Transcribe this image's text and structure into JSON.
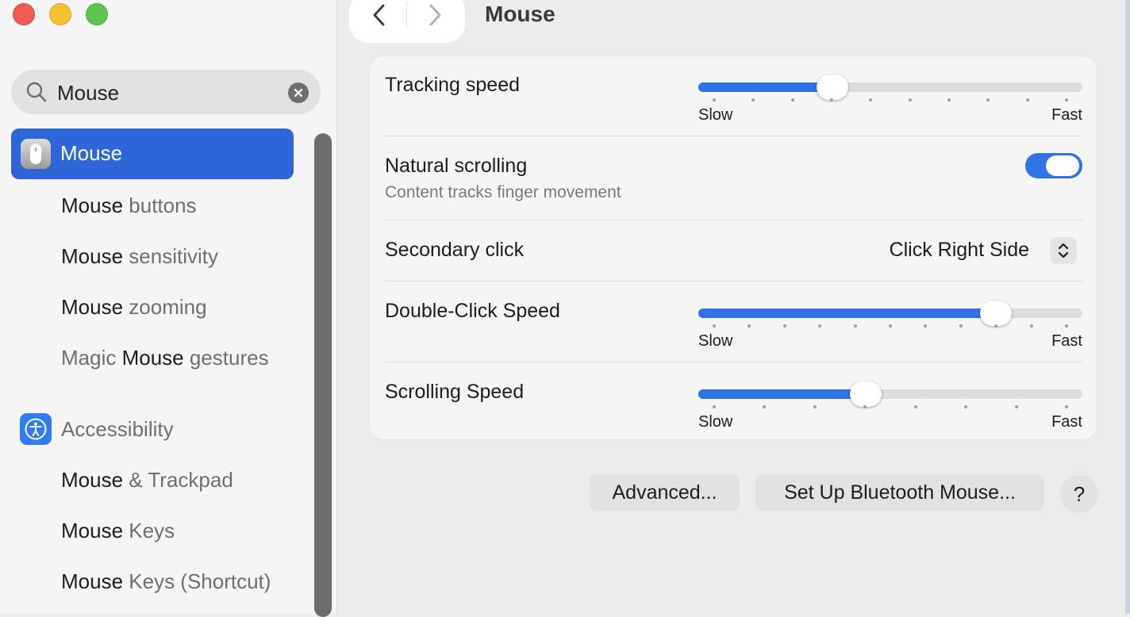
{
  "window": {
    "title": "Mouse"
  },
  "search": {
    "value": "Mouse"
  },
  "sidebar": {
    "selected": {
      "label": "Mouse",
      "icon": "mouse-icon"
    },
    "items": [
      {
        "match": "Mouse",
        "rest": " buttons"
      },
      {
        "match": "Mouse",
        "rest": " sensitivity"
      },
      {
        "match": "Mouse",
        "rest": " zooming"
      },
      {
        "pre": "Magic ",
        "match": "Mouse",
        "rest": " gestures"
      }
    ],
    "accessibility": {
      "label": "Accessibility",
      "icon": "accessibility-icon",
      "items": [
        {
          "match": "Mouse",
          "rest": " & Trackpad"
        },
        {
          "match": "Mouse",
          "rest": " Keys"
        },
        {
          "match": "Mouse",
          "rest": " Keys (Shortcut)"
        }
      ]
    }
  },
  "settings": {
    "tracking_speed": {
      "label": "Tracking speed",
      "min_label": "Slow",
      "max_label": "Fast",
      "value": 0.35,
      "ticks": 10
    },
    "natural_scrolling": {
      "label": "Natural scrolling",
      "description": "Content tracks finger movement",
      "enabled": true
    },
    "secondary_click": {
      "label": "Secondary click",
      "value": "Click Right Side"
    },
    "double_click_speed": {
      "label": "Double-Click Speed",
      "min_label": "Slow",
      "max_label": "Fast",
      "value": 0.775,
      "ticks": 11
    },
    "scrolling_speed": {
      "label": "Scrolling Speed",
      "min_label": "Slow",
      "max_label": "Fast",
      "value": 0.435,
      "ticks": 8
    }
  },
  "buttons": {
    "advanced": "Advanced...",
    "bluetooth": "Set Up Bluetooth Mouse...",
    "help": "?"
  },
  "colors": {
    "accent": "#2f73e6",
    "selection": "#2e66d9",
    "accessibility": "#2f7cf6"
  }
}
